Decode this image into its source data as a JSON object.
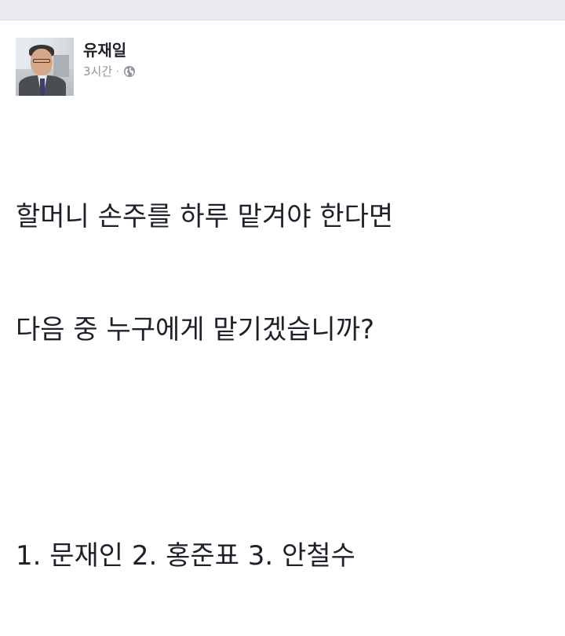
{
  "post": {
    "author": "유재일",
    "timestamp": "3시간",
    "separator": "·",
    "privacy_icon": "globe-icon",
    "text_lines": [
      "할머니 손주를 하루 맡겨야 한다면",
      "다음 중 누구에게 맡기겠습니까?",
      "",
      "1. 문재인 2. 홍준표 3. 안철수"
    ]
  },
  "colors": {
    "top_strip": "#e9ebee",
    "text": "#1d2129",
    "meta": "#90949c"
  }
}
